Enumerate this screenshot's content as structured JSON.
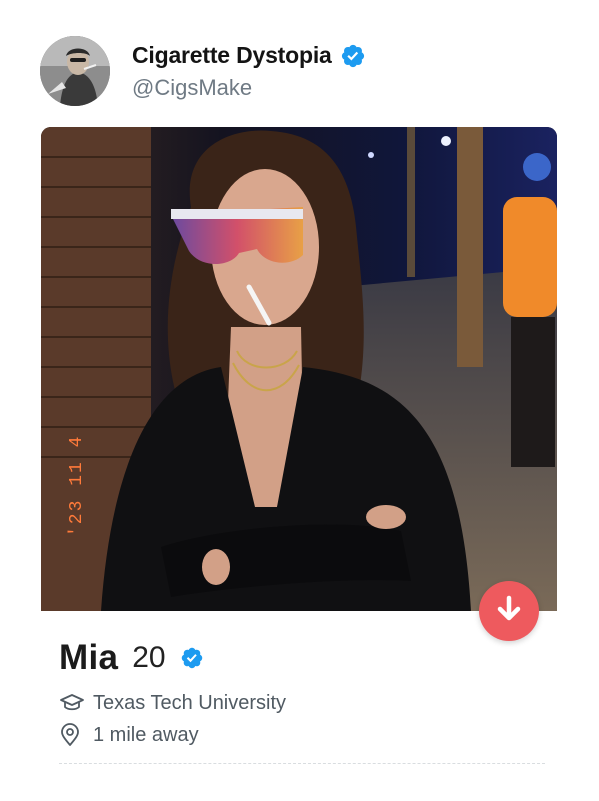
{
  "tweet": {
    "display_name": "Cigarette Dystopia",
    "handle": "@CigsMake",
    "verified": true
  },
  "profile_card": {
    "name": "Mia",
    "age": "20",
    "verified": true,
    "school": "Texas Tech University",
    "distance": "1 mile away",
    "photo_timestamp": "'23 11 4",
    "icons": {
      "school": "graduation-cap-icon",
      "distance": "location-pin-icon",
      "action": "arrow-down-icon"
    }
  },
  "colors": {
    "verified_blue": "#1d9bf0",
    "nope_red": "#ee5a5e",
    "timestamp_orange": "#ff7a3a"
  }
}
